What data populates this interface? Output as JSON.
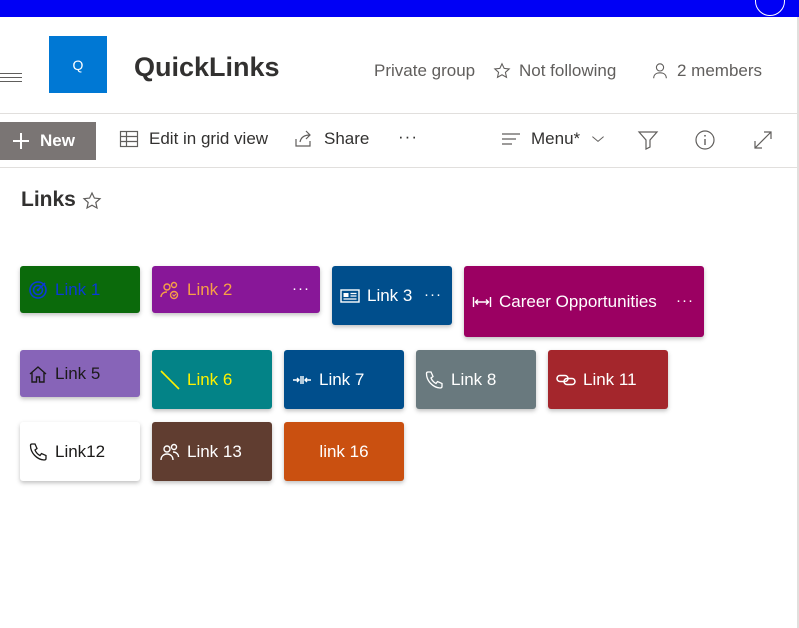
{
  "header": {
    "logo_letter": "Q",
    "site_title": "QuickLinks",
    "privacy": "Private group",
    "follow_label": "Not following",
    "members_label": "2 members"
  },
  "commandbar": {
    "new_label": "New",
    "edit_grid_label": "Edit in grid view",
    "share_label": "Share",
    "more_label": "···",
    "menu_label": "Menu*"
  },
  "list": {
    "title": "Links"
  },
  "tiles": [
    {
      "label": "Link 1",
      "bg": "#0b6a0b",
      "fg": "#0a3ad6",
      "icon": "target-icon"
    },
    {
      "label": "Link 2",
      "bg": "#881798",
      "fg": "#f7a046",
      "icon": "people-sync-icon",
      "more": "···"
    },
    {
      "label": "Link 3",
      "bg": "#004e8c",
      "fg": "#ffffff",
      "icon": "news-icon",
      "more": "···"
    },
    {
      "label": "Career Opportunities",
      "bg": "#9b0062",
      "fg": "#ffffff",
      "icon": "width-arrows-icon",
      "more": "···"
    },
    {
      "label": "Link 5",
      "bg": "#8764b8",
      "fg": "#1b1a19",
      "icon": "home-icon"
    },
    {
      "label": "Link 6",
      "bg": "#038387",
      "fg": "#fff100",
      "icon": "line-icon"
    },
    {
      "label": "Link 7",
      "bg": "#004e8c",
      "fg": "#ffffff",
      "icon": "collapse-arrows-icon"
    },
    {
      "label": "Link 8",
      "bg": "#69797e",
      "fg": "#ffffff",
      "icon": "phone-icon"
    },
    {
      "label": "Link 11",
      "bg": "#a4262c",
      "fg": "#ffffff",
      "icon": "link-icon"
    },
    {
      "label": "Link12",
      "bg": "#ffffff",
      "fg": "#1b1a19",
      "icon": "phone-icon"
    },
    {
      "label": "Link 13",
      "bg": "#603d30",
      "fg": "#ffffff",
      "icon": "people-icon"
    },
    {
      "label": "link 16",
      "bg": "#ca5010",
      "fg": "#ffffff",
      "icon": ""
    }
  ]
}
